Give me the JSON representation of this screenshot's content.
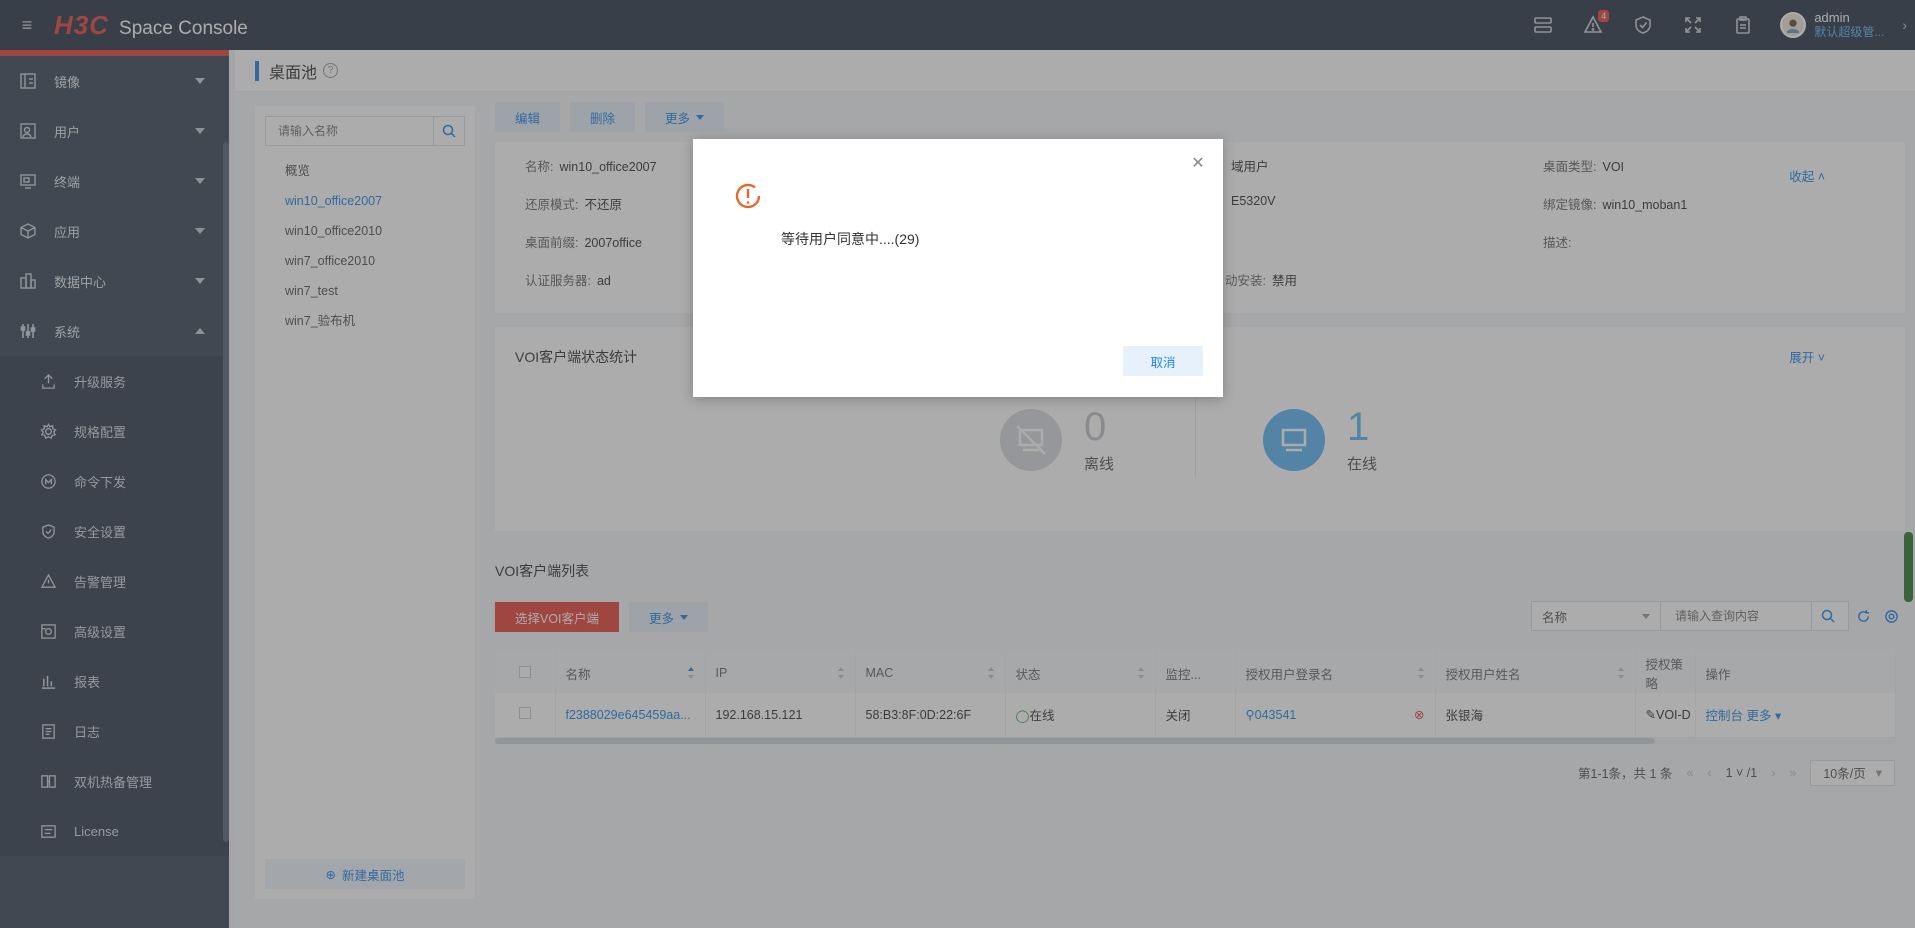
{
  "header": {
    "brand": "H3C",
    "product": "Space Console",
    "alert_count": "4",
    "user_name": "admin",
    "user_role": "默认超级管..."
  },
  "sidebar": {
    "items": [
      {
        "label": "镜像",
        "icon": "image-icon"
      },
      {
        "label": "用户",
        "icon": "user-icon"
      },
      {
        "label": "终端",
        "icon": "terminal-icon"
      },
      {
        "label": "应用",
        "icon": "app-icon"
      },
      {
        "label": "数据中心",
        "icon": "datacenter-icon"
      },
      {
        "label": "系统",
        "icon": "system-icon"
      }
    ],
    "system_sub": [
      {
        "label": "升级服务",
        "icon": "upgrade-icon"
      },
      {
        "label": "规格配置",
        "icon": "gear-icon"
      },
      {
        "label": "命令下发",
        "icon": "command-icon"
      },
      {
        "label": "安全设置",
        "icon": "shield-icon"
      },
      {
        "label": "告警管理",
        "icon": "alert-icon"
      },
      {
        "label": "高级设置",
        "icon": "advanced-icon"
      },
      {
        "label": "报表",
        "icon": "report-icon"
      },
      {
        "label": "日志",
        "icon": "log-icon"
      },
      {
        "label": "双机热备管理",
        "icon": "ha-icon"
      },
      {
        "label": "License",
        "icon": "license-icon"
      }
    ]
  },
  "page": {
    "title": "桌面池",
    "search_placeholder": "请输入名称",
    "pools": [
      "概览",
      "win10_office2007",
      "win10_office2010",
      "win7_office2010",
      "win7_test",
      "win7_验布机"
    ],
    "new_pool": "新建桌面池"
  },
  "toolbar": {
    "edit": "编辑",
    "delete": "删除",
    "more": "更多"
  },
  "info": {
    "name_k": "名称:",
    "name_v": "win10_office2007",
    "restore_k": "还原模式:",
    "restore_v": "不还原",
    "prefix_k": "桌面前缀:",
    "prefix_v": "2007office",
    "auth_k": "认证服务器:",
    "auth_v": "ad",
    "c2_1": "域用户",
    "c2_2": "E5320V",
    "c2_4_k": "动安装:",
    "c2_4_v": "禁用",
    "type_k": "桌面类型:",
    "type_v": "VOI",
    "image_k": "绑定镜像:",
    "image_v": "win10_moban1",
    "desc_k": "描述:",
    "collapse": "收起"
  },
  "stats": {
    "title": "VOI客户端状态统计",
    "expand": "展开",
    "offline_num": "0",
    "offline_label": "离线",
    "online_num": "1",
    "online_label": "在线"
  },
  "list": {
    "title": "VOI客户端列表",
    "select_btn": "选择VOI客户端",
    "more": "更多",
    "search_field": "名称",
    "query_placeholder": "请输入查询内容",
    "columns": [
      "名称",
      "IP",
      "MAC",
      "状态",
      "监控...",
      "授权用户登录名",
      "授权用户姓名",
      "授权策略",
      "操作"
    ],
    "row": {
      "name": "f2388029e645459aa...",
      "ip": "192.168.15.121",
      "mac": "58:B3:8F:0D:22:6F",
      "status": "在线",
      "monitor": "关闭",
      "login": "043541",
      "username": "张银海",
      "policy": "VOI-D",
      "op1": "控制台",
      "op2": "更多"
    }
  },
  "pager": {
    "summary": "第1-1条，共 1 条",
    "page": "1",
    "total": "/1",
    "size": "10条/页"
  },
  "dialog": {
    "message": "等待用户同意中....(29)",
    "cancel": "取消"
  },
  "colors": {
    "accent": "#1e88e5",
    "brand": "#e8453c"
  }
}
